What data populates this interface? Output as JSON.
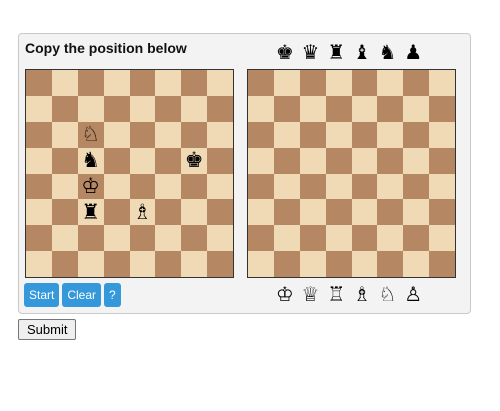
{
  "panel": {
    "title": "Copy the position below"
  },
  "palette_top": [
    {
      "name": "black-king-icon",
      "glyph": "♚"
    },
    {
      "name": "black-queen-icon",
      "glyph": "♛"
    },
    {
      "name": "black-rook-icon",
      "glyph": "♜"
    },
    {
      "name": "black-bishop-icon",
      "glyph": "♝"
    },
    {
      "name": "black-knight-icon",
      "glyph": "♞"
    },
    {
      "name": "black-pawn-icon",
      "glyph": "♟"
    }
  ],
  "palette_bottom": [
    {
      "name": "white-king-icon",
      "glyph": "♔"
    },
    {
      "name": "white-queen-icon",
      "glyph": "♕"
    },
    {
      "name": "white-rook-icon",
      "glyph": "♖"
    },
    {
      "name": "white-bishop-icon",
      "glyph": "♗"
    },
    {
      "name": "white-knight-icon",
      "glyph": "♘"
    },
    {
      "name": "white-pawn-icon",
      "glyph": "♙"
    }
  ],
  "source_board": {
    "pieces": [
      {
        "square": "c6",
        "glyph": "♘",
        "name": "white-knight-icon"
      },
      {
        "square": "c5",
        "glyph": "♞",
        "name": "black-knight-icon"
      },
      {
        "square": "g5",
        "glyph": "♚",
        "name": "black-king-icon"
      },
      {
        "square": "c4",
        "glyph": "♔",
        "name": "white-king-icon"
      },
      {
        "square": "c3",
        "glyph": "♜",
        "name": "black-rook-icon"
      },
      {
        "square": "e3",
        "glyph": "♗",
        "name": "white-bishop-icon"
      }
    ]
  },
  "target_board": {
    "pieces": []
  },
  "buttons": {
    "start": "Start",
    "clear": "Clear",
    "help": "?"
  },
  "submit_label": "Submit"
}
